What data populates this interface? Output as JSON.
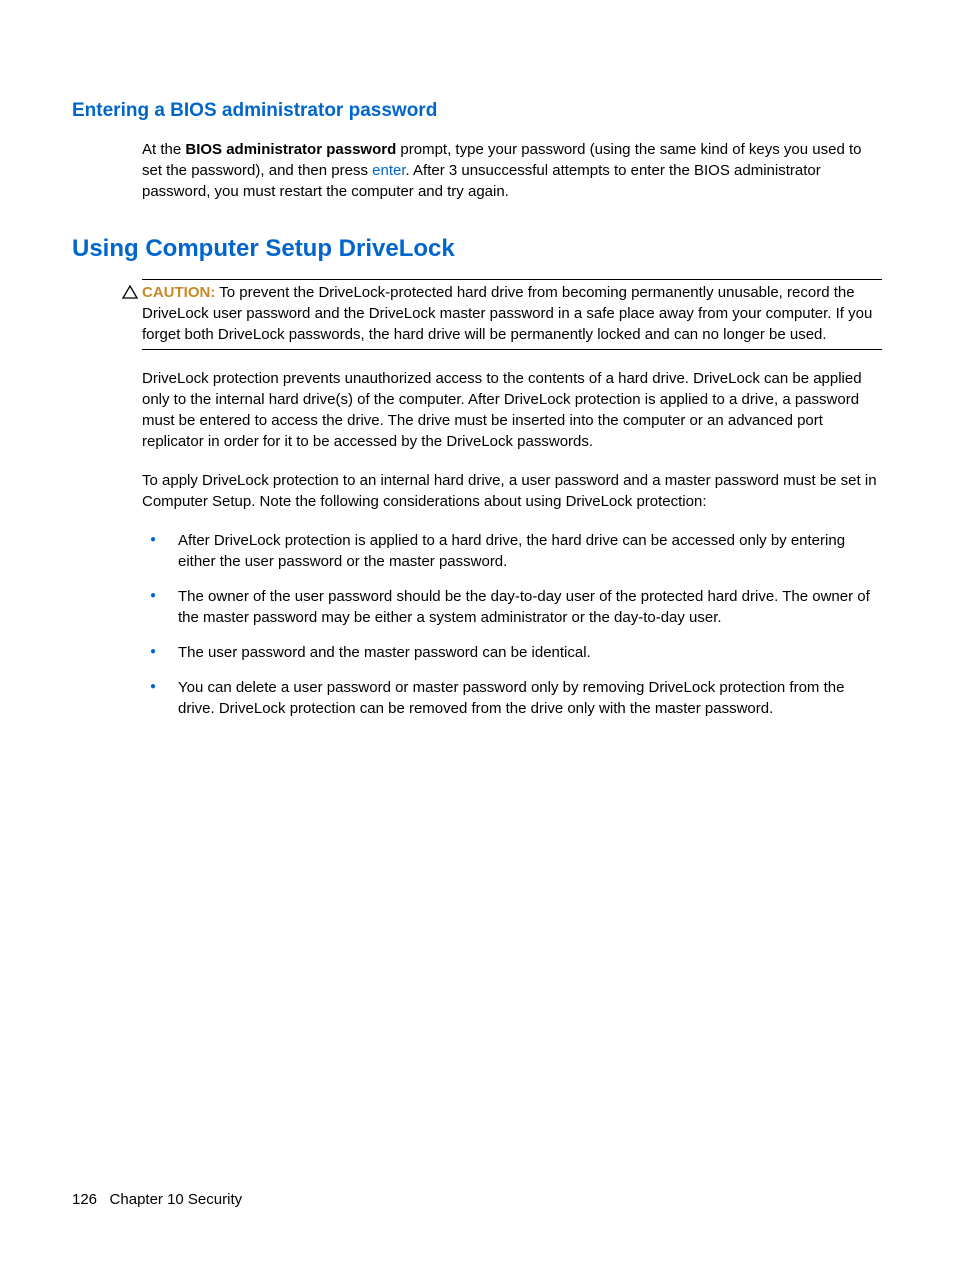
{
  "section1": {
    "heading": "Entering a BIOS administrator password",
    "paragraph_pre": "At the ",
    "paragraph_bold": "BIOS administrator password",
    "paragraph_mid": " prompt, type your password (using the same kind of keys you used to set the password), and then press ",
    "paragraph_link": "enter",
    "paragraph_post": ". After 3 unsuccessful attempts to enter the BIOS administrator password, you must restart the computer and try again."
  },
  "section2": {
    "heading": "Using Computer Setup DriveLock",
    "caution_label": "CAUTION:",
    "caution_text": "   To prevent the DriveLock-protected hard drive from becoming permanently unusable, record the DriveLock user password and the DriveLock master password in a safe place away from your computer. If you forget both DriveLock passwords, the hard drive will be permanently locked and can no longer be used.",
    "paragraph1": "DriveLock protection prevents unauthorized access to the contents of a hard drive. DriveLock can be applied only to the internal hard drive(s) of the computer. After DriveLock protection is applied to a drive, a password must be entered to access the drive. The drive must be inserted into the computer or an advanced port replicator in order for it to be accessed by the DriveLock passwords.",
    "paragraph2": "To apply DriveLock protection to an internal hard drive, a user password and a master password must be set in Computer Setup. Note the following considerations about using DriveLock protection:",
    "bullets": [
      "After DriveLock protection is applied to a hard drive, the hard drive can be accessed only by entering either the user password or the master password.",
      "The owner of the user password should be the day-to-day user of the protected hard drive. The owner of the master password may be either a system administrator or the day-to-day user.",
      "The user password and the master password can be identical.",
      "You can delete a user password or master password only by removing DriveLock protection from the drive. DriveLock protection can be removed from the drive only with the master password."
    ]
  },
  "footer": {
    "page_number": "126",
    "chapter": "Chapter 10   Security"
  }
}
